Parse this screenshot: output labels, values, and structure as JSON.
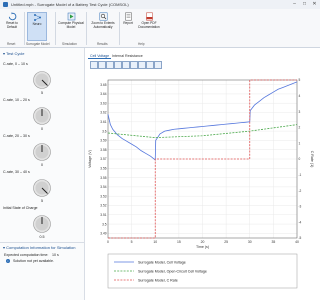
{
  "window": {
    "title": "Untitled.mph - Surrogate Model of a Battery Test Cycle (COMSOL)",
    "controls": [
      "–",
      "□",
      "✕"
    ]
  },
  "ribbon": {
    "groups": [
      {
        "label": "Reset",
        "buttons": [
          {
            "label": "Reset to Default",
            "icon": "reset-icon"
          }
        ]
      },
      {
        "label": "Surrogate Model",
        "buttons": [
          {
            "label": "Neuro",
            "icon": "neural-network-icon",
            "active": true
          }
        ]
      },
      {
        "label": "Simulation",
        "buttons": [
          {
            "label": "Compute Physical Model",
            "icon": "compute-icon"
          }
        ]
      },
      {
        "label": "Results",
        "buttons": [
          {
            "label": "Zoom to Extents Automatically",
            "icon": "zoom-extents-icon"
          }
        ]
      },
      {
        "label": "Help",
        "buttons": [
          {
            "label": "Report",
            "icon": "report-icon"
          },
          {
            "label": "Open PDF Documentation",
            "icon": "pdf-icon"
          }
        ]
      }
    ]
  },
  "test_cycle": {
    "header": "Test Cycle",
    "knobs": [
      {
        "label": "C-rate, 0 – 10 s",
        "value": "5"
      },
      {
        "label": "C-rate, 10 – 20 s",
        "value": "0"
      },
      {
        "label": "C-rate, 20 – 30 s",
        "value": "0"
      },
      {
        "label": "C-rate, 30 – 40 s",
        "value": "5"
      },
      {
        "label": "Initial State of Charge",
        "value": "0.5"
      }
    ]
  },
  "computation": {
    "header": "Computation Information for Simulation",
    "expected_time_label": "Expected computation time:",
    "expected_time_value": "10 s",
    "status": "Solution not yet available."
  },
  "plot": {
    "tabs": [
      "Cell Voltage",
      "Internal Resistance"
    ],
    "active_tab": 0,
    "toolbar_icons": [
      "zoom-in-icon",
      "zoom-out-icon",
      "zoom-box-icon",
      "zoom-extents-icon",
      "scene-light-icon",
      "grid-icon",
      "legend-icon",
      "image-export-icon",
      "data-export-icon"
    ],
    "legend": [
      {
        "name": "Surrogate Model, Cell Voltage",
        "color": "#5577dd",
        "style": "solid"
      },
      {
        "name": "Surrogate Model, Open-Circuit Cell Voltage",
        "color": "#4aa84a",
        "style": "dashed"
      },
      {
        "name": "Surrogate Model, C Rate",
        "color": "#e05252",
        "style": "dashed"
      }
    ]
  },
  "chart_data": {
    "type": "line",
    "xlabel": "Time (s)",
    "ylabel": "Voltage (V)",
    "y2label": "C Rate (1)",
    "xlim": [
      0,
      40
    ],
    "ylim": [
      3.485,
      3.655
    ],
    "y2lim": [
      -5,
      5
    ],
    "x_ticks": [
      "0",
      "5",
      "10",
      "15",
      "20",
      "25",
      "30",
      "35",
      "40"
    ],
    "y_ticks": [
      "3.65",
      "3.64",
      "3.63",
      "3.62",
      "3.61",
      "3.6",
      "3.59",
      "3.58",
      "3.57",
      "3.56",
      "3.55",
      "3.54",
      "3.53",
      "3.52",
      "3.51",
      "3.5",
      "3.49"
    ],
    "y2_ticks": [
      "5",
      "4",
      "3",
      "2",
      "1",
      "0",
      "-1",
      "-2",
      "-3",
      "-4",
      "-5"
    ],
    "grid": true,
    "series": [
      {
        "name": "Surrogate Model, Cell Voltage",
        "axis": "left",
        "x": [
          0,
          0.5,
          1,
          2,
          3,
          4,
          5,
          6,
          7,
          8,
          9,
          10,
          10.1,
          11,
          12,
          13,
          14,
          15,
          16,
          17,
          18,
          19,
          20,
          21,
          22,
          23,
          24,
          25,
          26,
          27,
          28,
          29,
          30,
          30.1,
          31,
          32,
          33,
          34,
          35,
          36,
          37,
          38,
          39,
          40
        ],
        "values": [
          3.618,
          3.607,
          3.602,
          3.596,
          3.592,
          3.589,
          3.586,
          3.583,
          3.579,
          3.576,
          3.573,
          3.569,
          3.59,
          3.597,
          3.6,
          3.601,
          3.602,
          3.6025,
          3.603,
          3.6035,
          3.604,
          3.6045,
          3.605,
          3.6055,
          3.606,
          3.6065,
          3.607,
          3.6075,
          3.608,
          3.6085,
          3.609,
          3.6095,
          3.61,
          3.622,
          3.628,
          3.632,
          3.636,
          3.639,
          3.642,
          3.645,
          3.647,
          3.649,
          3.651,
          3.653
        ]
      },
      {
        "name": "Surrogate Model, Open-Circuit Cell Voltage",
        "axis": "left",
        "x": [
          0,
          10,
          20,
          30,
          40
        ],
        "values": [
          3.598,
          3.593,
          3.595,
          3.6,
          3.607
        ]
      },
      {
        "name": "Surrogate Model, C Rate",
        "axis": "right",
        "x": [
          0,
          10,
          10,
          30,
          30,
          40
        ],
        "values": [
          -5,
          -5,
          0,
          0,
          5,
          5
        ]
      }
    ]
  }
}
